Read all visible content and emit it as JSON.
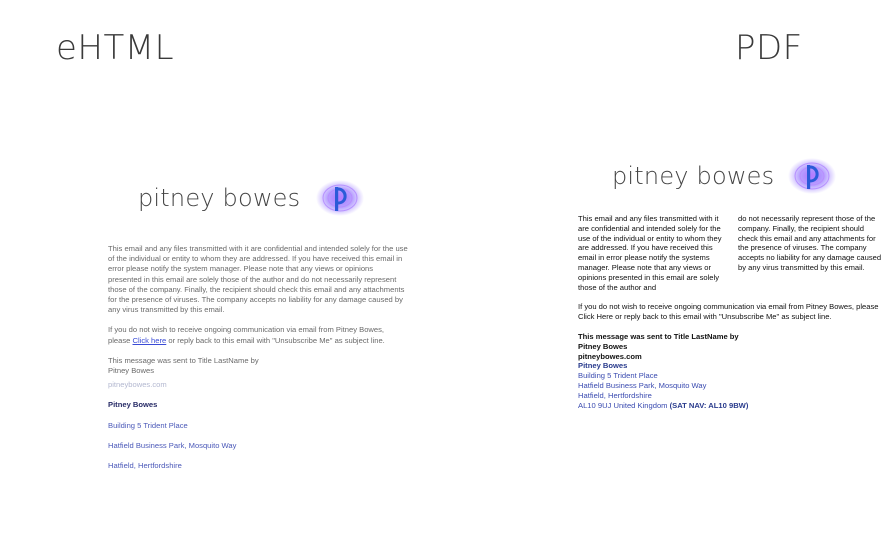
{
  "headings": {
    "left": "eHTML",
    "right": "PDF"
  },
  "logo": {
    "wordmark": "pitney bowes",
    "mark": "pitney-bowes-p-icon"
  },
  "colors": {
    "link": "#3a4bd6",
    "brand_navy": "#283a8c",
    "address_blue": "#3a4bb0",
    "logo_glow": "#6a3cff"
  },
  "left_doc": {
    "disclaimer": "This email and any files transmitted with it are confidential and intended solely for the use of the individual or entity to whom they are addressed. If you have received this email in error please notify the system manager. Please note that any views or opinions presented in this email are solely those of the author and do not necessarily represent those of the company. Finally, the recipient should check this email and any attachments for the presence of viruses. The company accepts no liability for any damage caused by any virus transmitted by this email.",
    "unsubscribe_pre": "If you do not wish to receive ongoing communication via email from Pitney Bowes, please ",
    "unsubscribe_link": "Click here",
    "unsubscribe_post": " or reply back to this email with \"Unsubscribe Me\" as subject line.",
    "sent_to": "This message was sent to Title LastName by",
    "sender": "Pitney Bowes",
    "website": "pitneybowes.com",
    "company": "Pitney Bowes",
    "address_1": "Building 5 Trident Place",
    "address_2": "Hatfield Business Park, Mosquito Way",
    "address_3": "Hatfield, Hertfordshire"
  },
  "right_doc": {
    "col1": "This email and any files transmitted with it are confidential and intended solely for the use of the individual or entity to whom they are addressed. If you have received this email in error please notify the systems manager. Please note that any views or opinions presented in this email are solely those of the author and",
    "col2": "do not necessarily represent those of the company. Finally, the recipient should check this email and any attachments for the presence of viruses. The company accepts no liability for any damage caused by any virus transmitted by this email.",
    "unsubscribe": "If you do not wish to receive ongoing communication via email from Pitney Bowes, please Click Here or reply back to this email with \"Unsubscribe Me\" as subject line.",
    "sent_to": "This message was sent to Title LastName by",
    "sender": "Pitney Bowes",
    "website": "pitneybowes.com",
    "company": "Pitney Bowes",
    "address_1": "Building 5 Trident Place",
    "address_2": "Hatfield Business Park, Mosquito Way",
    "address_3": "Hatfield, Hertfordshire",
    "postcode": "AL10 9UJ United Kingdom",
    "satnav": "(SAT NAV: AL10 9BW)"
  }
}
